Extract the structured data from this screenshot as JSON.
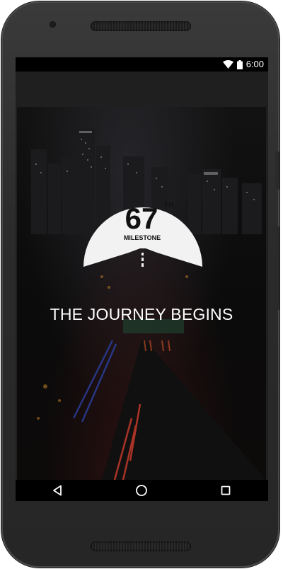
{
  "status_bar": {
    "time": "6:00",
    "icons": [
      "wifi-icon",
      "battery-icon"
    ]
  },
  "splash": {
    "logo": {
      "number": "67",
      "superscript": "TH",
      "word": "MILESTONE"
    },
    "tagline": "THE JOURNEY BEGINS",
    "background": "night-city-highway"
  },
  "navigation_bar": {
    "buttons": [
      "back-icon",
      "home-icon",
      "recents-icon"
    ]
  },
  "colors": {
    "screen_bg": "#1f1f1f",
    "status_bar_bg": "#000000",
    "text": "#ffffff",
    "logo_fill": "#f2f2f2",
    "logo_text": "#111111"
  }
}
